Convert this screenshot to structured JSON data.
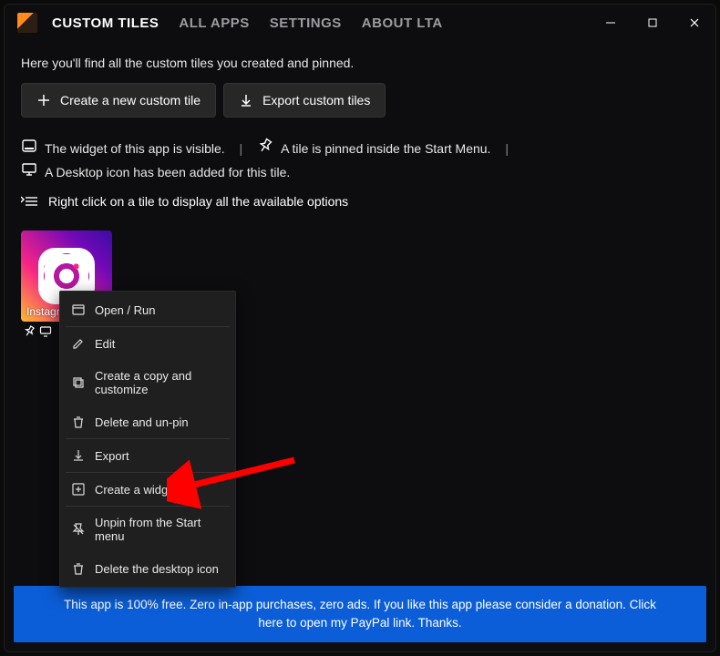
{
  "tabs": {
    "custom_tiles": "CUSTOM TILES",
    "all_apps": "ALL APPS",
    "settings": "SETTINGS",
    "about": "ABOUT LTA"
  },
  "intro": "Here you'll find all the custom tiles you created and pinned.",
  "toolbar": {
    "create": "Create a new custom tile",
    "export": "Export custom tiles"
  },
  "legend": {
    "widget_visible": "The widget of this app is visible.",
    "tile_pinned": "A tile is pinned inside the Start Menu.",
    "desktop_icon": "A Desktop icon has been added for this tile.",
    "separator": "|"
  },
  "hint": "Right click on a tile to display all the available options",
  "tile": {
    "name": "Instagram"
  },
  "context_menu": {
    "open_run": "Open / Run",
    "edit": "Edit",
    "copy_customize": "Create a copy and customize",
    "delete_unpin": "Delete and un-pin",
    "export": "Export",
    "create_widget": "Create a widget",
    "unpin_start": "Unpin from the Start menu",
    "delete_desktop": "Delete the desktop icon"
  },
  "footer": "This app is 100% free. Zero in-app purchases, zero ads. If you like this app please consider a donation. Click here to open my PayPal link. Thanks."
}
